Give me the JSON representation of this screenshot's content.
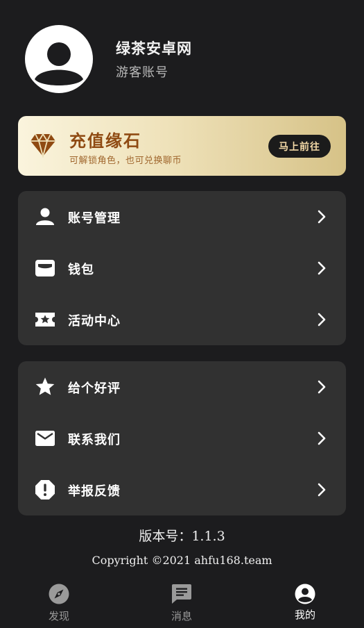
{
  "profile": {
    "username": "绿茶安卓网",
    "account_type": "游客账号",
    "avatar_icon": "user-avatar-icon"
  },
  "recharge": {
    "title": "充值缘石",
    "subtitle": "可解锁角色，也可兑换聊币",
    "button_label": "马上前往",
    "icon": "diamond-icon",
    "accent": "#8f4a12"
  },
  "menu_groups": [
    {
      "items": [
        {
          "label": "账号管理",
          "icon": "person-icon"
        },
        {
          "label": "钱包",
          "icon": "wallet-icon"
        },
        {
          "label": "活动中心",
          "icon": "ticket-star-icon"
        }
      ]
    },
    {
      "items": [
        {
          "label": "给个好评",
          "icon": "star-icon"
        },
        {
          "label": "联系我们",
          "icon": "mail-icon"
        },
        {
          "label": "举报反馈",
          "icon": "alert-icon"
        }
      ]
    }
  ],
  "footer": {
    "version": "版本号：1.1.3",
    "copyright": "Copyright ©2021 ahfu168.team"
  },
  "bottom_nav": {
    "items": [
      {
        "label": "发现",
        "icon": "compass-icon",
        "active": false
      },
      {
        "label": "消息",
        "icon": "message-icon",
        "active": false
      },
      {
        "label": "我的",
        "icon": "account-circle-icon",
        "active": true
      }
    ]
  }
}
